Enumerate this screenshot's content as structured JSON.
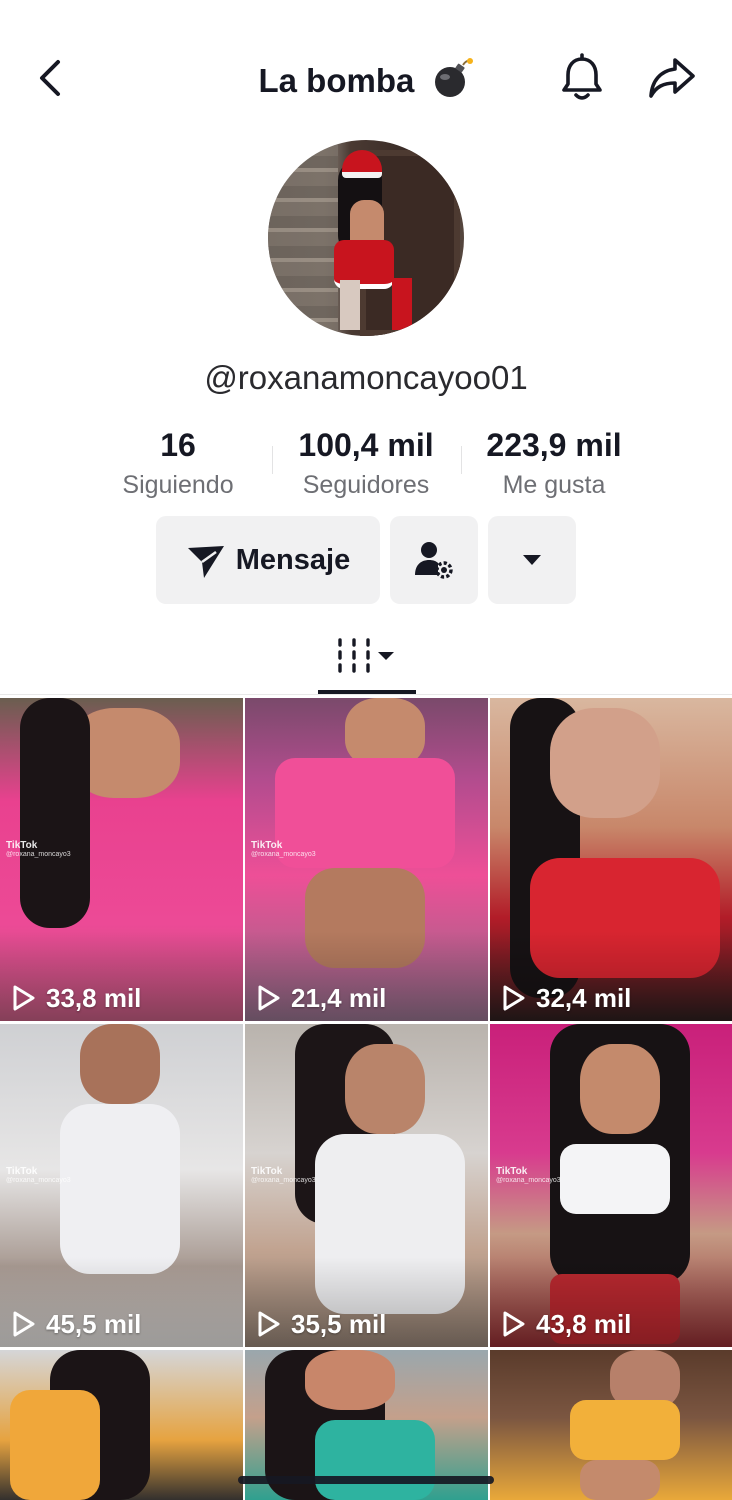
{
  "header": {
    "title": "La bomba",
    "back_icon": "chevron-left-icon",
    "bell_icon": "bell-icon",
    "share_icon": "share-arrow-icon",
    "title_emoji_icon": "bomb-icon"
  },
  "profile": {
    "username": "@roxanamoncayoo01",
    "stats": [
      {
        "value": "16",
        "label": "Siguiendo"
      },
      {
        "value": "100,4 mil",
        "label": "Seguidores"
      },
      {
        "value": "223,9 mil",
        "label": "Me gusta"
      }
    ],
    "message_button": "Mensaje"
  },
  "tabs": {
    "active_icon": "grid-videos-icon"
  },
  "videos": [
    {
      "views": "33,8 mil",
      "watermark": "TikTok",
      "handle": "@roxana_moncayo3"
    },
    {
      "views": "21,4 mil",
      "watermark": "TikTok",
      "handle": "@roxana_moncayo3"
    },
    {
      "views": "32,4 mil",
      "watermark": "",
      "handle": ""
    },
    {
      "views": "45,5 mil",
      "watermark": "TikTok",
      "handle": "@roxana_moncayo3"
    },
    {
      "views": "35,5 mil",
      "watermark": "TikTok",
      "handle": "@roxana_moncayo3"
    },
    {
      "views": "43,8 mil",
      "watermark": "TikTok",
      "handle": "@roxana_moncayo3"
    },
    {
      "views": "",
      "watermark": "",
      "handle": ""
    },
    {
      "views": "",
      "watermark": "",
      "handle": ""
    },
    {
      "views": "",
      "watermark": "",
      "handle": ""
    }
  ],
  "colors": {
    "text": "#161823",
    "secondary": "#6e6f74",
    "button_bg": "#f1f1f2"
  }
}
